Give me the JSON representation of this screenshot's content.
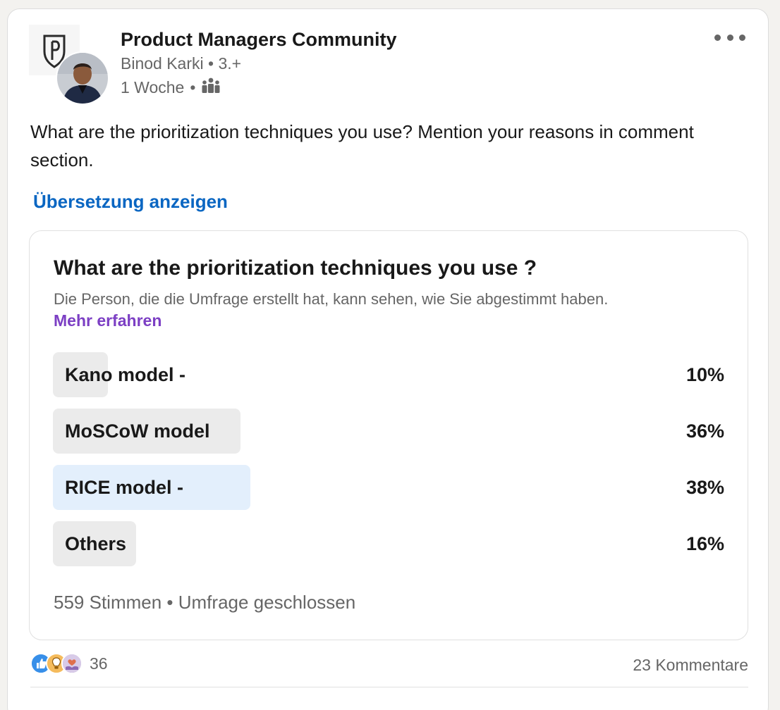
{
  "post": {
    "group_name": "Product Managers Community",
    "author_name": "Binod Karki",
    "connection_degree": "3.+",
    "time_ago": "1 Woche",
    "visibility_icon": "group-visibility-icon",
    "more_icon": "more-dots-icon",
    "text": "What are the prioritization techniques you use? Mention your reasons in comment section.",
    "translate_label": "Übersetzung anzeigen"
  },
  "poll": {
    "question": "What are the prioritization techniques you use ?",
    "privacy_note": "Die Person, die die Umfrage erstellt hat, kann sehen, wie Sie abgestimmt haben.",
    "learn_more": "Mehr erfahren",
    "options": [
      {
        "label": "Kano model -",
        "percent_text": "10%",
        "percent": 10,
        "winner": false
      },
      {
        "label": "MoSCoW model",
        "percent_text": "36%",
        "percent": 36,
        "winner": false
      },
      {
        "label": "RICE model -",
        "percent_text": "38%",
        "percent": 38,
        "winner": true
      },
      {
        "label": "Others",
        "percent_text": "16%",
        "percent": 16,
        "winner": false
      }
    ],
    "votes": "559 Stimmen",
    "status": "Umfrage geschlossen"
  },
  "social": {
    "reaction_icons": [
      "like-icon",
      "insightful-icon",
      "support-icon"
    ],
    "reaction_count": "36",
    "comments": "23 Kommentare"
  },
  "colors": {
    "link_blue": "#0a66c2",
    "learn_more_purple": "#7c3fc4",
    "poll_bar_gray": "#ebebeb",
    "poll_bar_winner": "#e3effc"
  }
}
